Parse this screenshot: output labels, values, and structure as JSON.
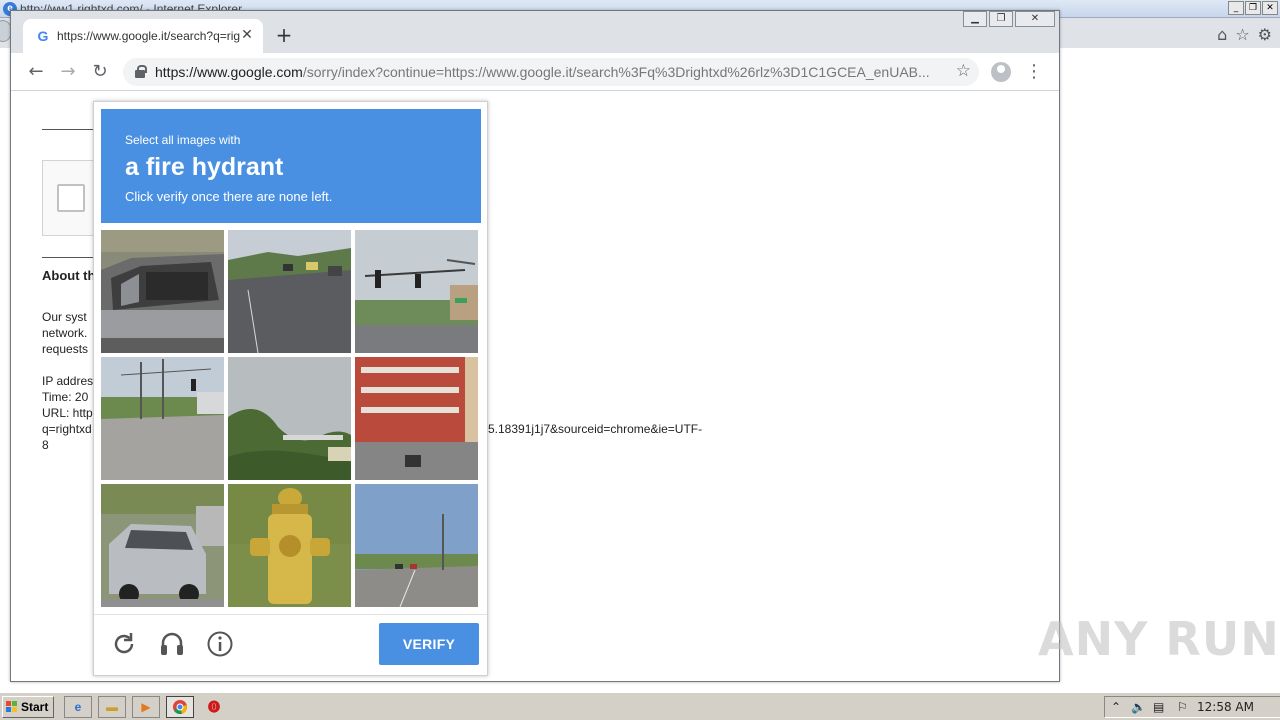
{
  "ie_window": {
    "title": "http://ww1.rightxd.com/ - Internet Explorer",
    "controls": [
      "_",
      "❐",
      "✕"
    ]
  },
  "chrome": {
    "tab_title": "https://www.google.it/search?q=rig",
    "tab_close": "✕",
    "new_tab": "+",
    "back": "←",
    "forward": "→",
    "reload": "↻",
    "url_host": "https://www.google.com",
    "url_rest": "/sorry/index?continue=https://www.google.it/search%3Fq%3Drightxd%26rlz%3D1C1GCEA_enUAB...",
    "star": "☆",
    "menu": "⋮",
    "win_controls": [
      "▁",
      "❐",
      "✕"
    ]
  },
  "page": {
    "about": "About th",
    "lines": [
      "Our syst",
      "network.",
      "requests",
      "",
      "IP addres",
      "Time: 20",
      "URL: http",
      "q=rightxd",
      "8"
    ],
    "url_tail": "5.18391j1j7&sourceid=chrome&ie=UTF-"
  },
  "captcha": {
    "select_text": "Select all images with",
    "target": "a fire hydrant",
    "instruction": "Click verify once there are none left.",
    "tiles": [
      "pickup-truck",
      "road-with-cars",
      "traffic-light-intersection",
      "street-with-poles",
      "trees-and-bridge",
      "red-brick-building",
      "silver-suv",
      "yellow-fire-hydrant",
      "highway-road"
    ],
    "verify_label": "VERIFY",
    "header_color": "#4a90e2"
  },
  "watermark": "ANY RUN",
  "taskbar": {
    "start": "Start",
    "clock": "12:58 AM"
  }
}
